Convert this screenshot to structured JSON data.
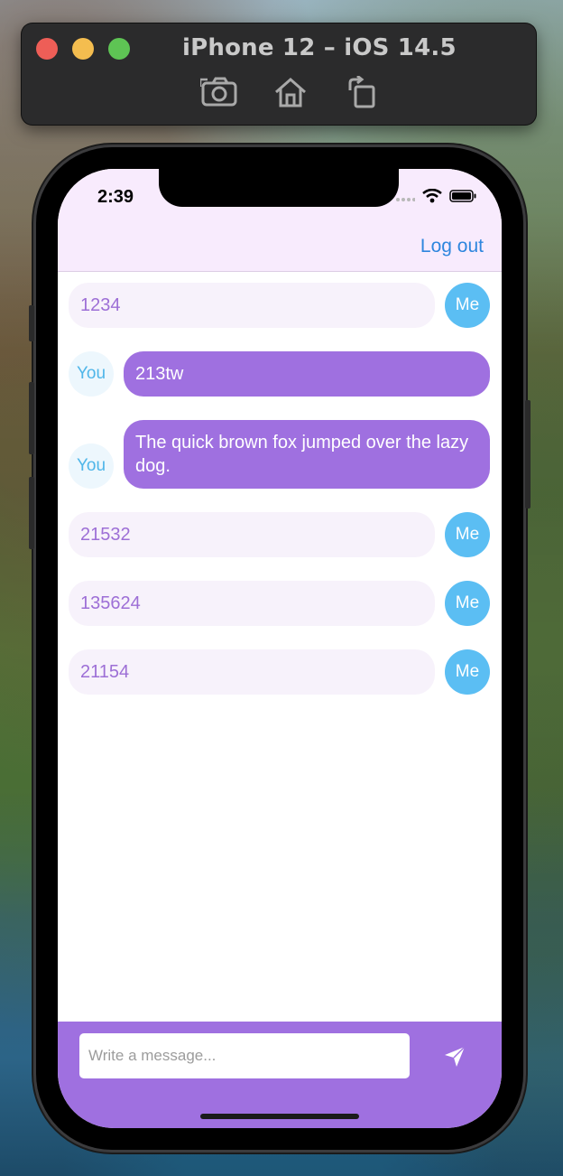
{
  "simulator": {
    "title": "iPhone 12 – iOS 14.5",
    "toolbar_icons": [
      "camera-icon",
      "home-icon",
      "rotate-icon"
    ]
  },
  "status_bar": {
    "time": "2:39",
    "icons": [
      "signal-icon",
      "wifi-icon",
      "battery-icon"
    ]
  },
  "header": {
    "logout_label": "Log out"
  },
  "messages": [
    {
      "sender": "me",
      "avatar": "Me",
      "text": "1234"
    },
    {
      "sender": "you",
      "avatar": "You",
      "text": "213tw"
    },
    {
      "sender": "you",
      "avatar": "You",
      "text": "The quick brown fox jumped over the lazy dog."
    },
    {
      "sender": "me",
      "avatar": "Me",
      "text": "21532"
    },
    {
      "sender": "me",
      "avatar": "Me",
      "text": "135624"
    },
    {
      "sender": "me",
      "avatar": "Me",
      "text": "21154"
    }
  ],
  "composer": {
    "placeholder": "Write a message...",
    "value": "",
    "send_icon": "send-icon"
  },
  "colors": {
    "header_bg": "#f8ebfd",
    "accent": "#9f70e0",
    "me_bubble_bg": "#f7f2fb",
    "me_text": "#9d6fd6",
    "me_avatar": "#5bbef3",
    "you_avatar_bg": "#edf7fd",
    "you_avatar_text": "#4fb6e9",
    "link": "#2e86de"
  }
}
